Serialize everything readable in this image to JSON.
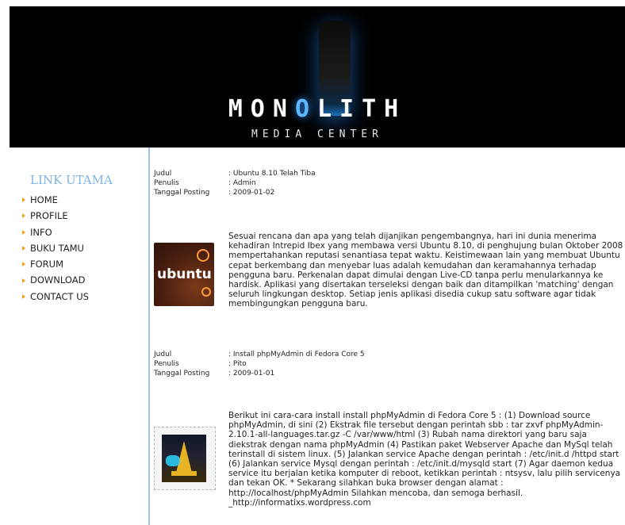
{
  "header": {
    "title_pre": "MON",
    "title_hl": "O",
    "title_post": "LITH",
    "subtitle": "MEDIA CENTER"
  },
  "sidebar": {
    "title": "LINK UTAMA",
    "items": [
      "HOME",
      "PROFILE",
      "INFO",
      "BUKU TAMU",
      "FORUM",
      "DOWNLOAD",
      "CONTACT US"
    ]
  },
  "posts": [
    {
      "labels": {
        "judul": "Judul",
        "penulis": "Penulis",
        "tanggal": "Tanggal Posting"
      },
      "judul": ": Ubuntu 8.10 Telah Tiba",
      "penulis": ": Admin",
      "tanggal": ": 2009-01-02",
      "thumb_text": "ubuntu",
      "body": "Sesuai rencana dan apa yang telah dijanjikan pengembangnya, hari ini dunia menerima kehadiran Intrepid Ibex yang membawa versi Ubuntu 8.10, di penghujung bulan Oktober 2008 mempertahankan reputasi senantiasa tepat waktu. Keistimewaan lain yang membuat Ubuntu cepat berkembang dan menyebar luas adalah kemudahan dan keramahannya terhadap pengguna baru. Perkenalan dapat dimulai dengan Live-CD tanpa perlu menularkannya ke hardisk. Aplikasi yang disertakan terseleksi dengan baik dan ditampilkan 'matching' dengan seluruh lingkungan desktop. Setiap jenis aplikasi disedia cukup satu software agar tidak membingungkan pengguna baru."
    },
    {
      "labels": {
        "judul": "Judul",
        "penulis": "Penulis",
        "tanggal": "Tanggal Posting"
      },
      "judul": ": Install phpMyAdmin di Fedora Core 5",
      "penulis": ": Pito",
      "tanggal": ": 2009-01-01",
      "body": "Berikut ini cara-cara install install phpMyAdmin di Fedora Core 5 : (1) Download source phpMyAdmin, di sini (2) Ekstrak file tersebut dengan perintah sbb : tar zxvf phpMyAdmin-2.10.1-all-languages.tar.gz -C /var/www/html (3) Rubah nama direktori yang baru saja diekstrak dengan nama phpMyAdmin (4) Pastikan paket Webserver Apache dan MySql telah terinstall di sistem linux. (5) Jalankan service Apache dengan perintah : /etc/init.d /httpd start (6) Jalankan service Mysql dengan perintah : /etc/init.d/mysqld start (7) Agar daemon kedua service itu berjalan ketika komputer di reboot, ketikkan perintah : ntsysv, lalu pilih servicenya dan tekan OK. * Sekarang silahkan buka browser dengan alamat : http://localhost/phpMyAdmin Silahkan mencoba, dan semoga berhasil. _http://informatixs.wordpress.com"
    }
  ]
}
